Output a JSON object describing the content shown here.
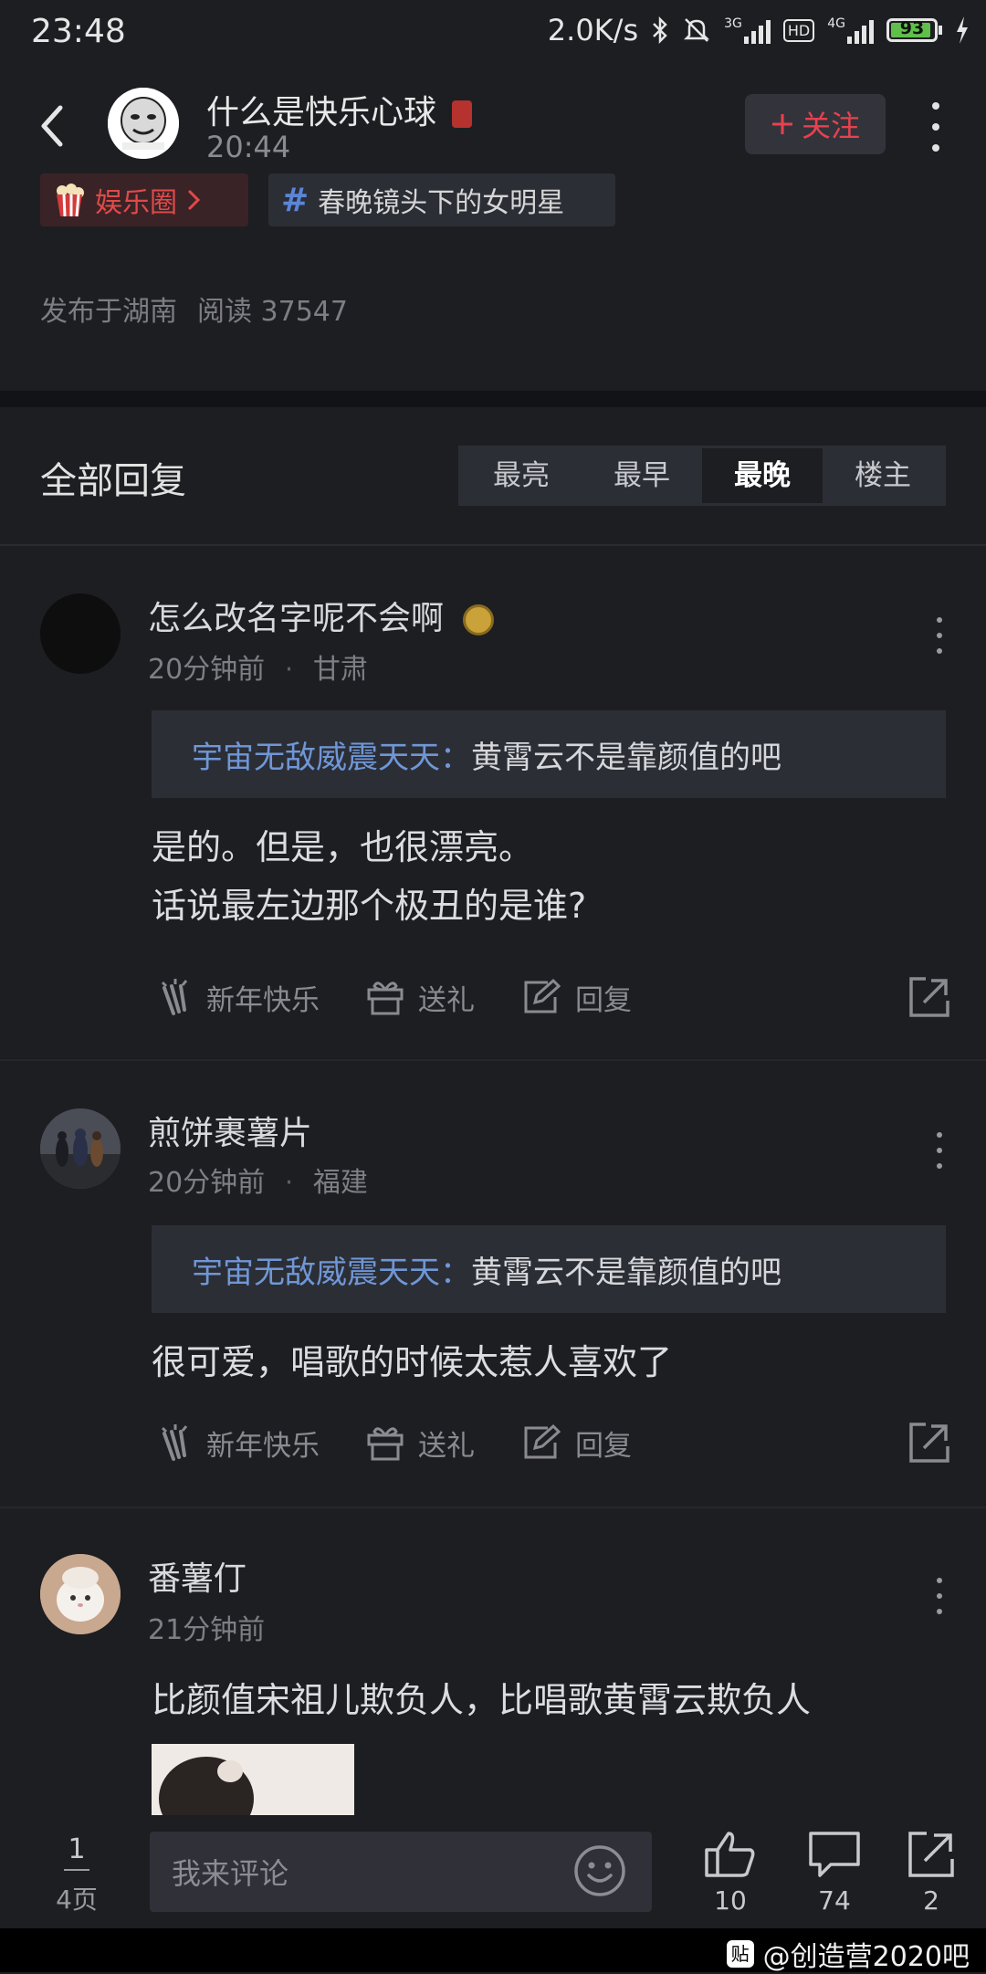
{
  "status_bar": {
    "time": "23:48",
    "net_speed": "2.0K/s",
    "net_3g": "3G",
    "hd": "HD",
    "net_4g": "4G",
    "battery": "93"
  },
  "header": {
    "title": "什么是快乐心球",
    "time": "20:44",
    "follow_label": "关注"
  },
  "tags": [
    {
      "label": "娱乐圈"
    },
    {
      "label": "春晚镜头下的女明星"
    }
  ],
  "meta": {
    "location": "发布于湖南",
    "reads": "阅读 37547"
  },
  "replies": {
    "title": "全部回复",
    "sort_options": [
      "最亮",
      "最早",
      "最晚",
      "楼主"
    ],
    "active_sort": "最晚"
  },
  "comments": [
    {
      "name": "怎么改名字呢不会啊",
      "time": "20分钟前",
      "location": "甘肃",
      "quote_name": "宇宙无敌威震天天",
      "quote_colon": "：",
      "quote_text": "黄霄云不是靠颜值的吧",
      "body_lines": [
        "是的。但是，也很漂亮。",
        "话说最左边那个极丑的是谁?"
      ]
    },
    {
      "name": "煎饼裹薯片",
      "time": "20分钟前",
      "location": "福建",
      "quote_name": "宇宙无敌威震天天",
      "quote_colon": "：",
      "quote_text": "黄霄云不是靠颜值的吧",
      "body_lines": [
        "很可爱，唱歌的时候太惹人喜欢了"
      ]
    },
    {
      "name": "番薯仃",
      "time": "21分钟前",
      "body_lines": [
        "比颜值宋祖儿欺负人，比唱歌黄霄云欺负人"
      ]
    }
  ],
  "actions": {
    "newyear": "新年快乐",
    "gift": "送礼",
    "reply": "回复"
  },
  "bottom_bar": {
    "page_current": "1",
    "page_total": "4页",
    "input_placeholder": "我来评论",
    "likes": "10",
    "comments": "74",
    "shares": "2"
  },
  "watermark": {
    "logo": "贴",
    "text": "@创造营2020吧"
  },
  "colors": {
    "background": "#1d1e22",
    "accent_red": "#e8414f",
    "link_blue": "#6f97d6"
  }
}
